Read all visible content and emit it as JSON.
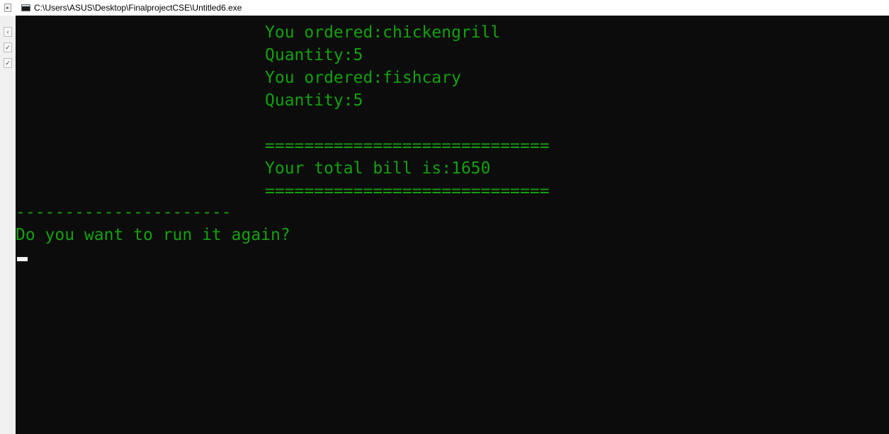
{
  "window": {
    "title": "C:\\Users\\ASUS\\Desktop\\FinalprojectCSE\\Untitled6.exe"
  },
  "console": {
    "text_color": "#13a10e",
    "background": "#0c0c0c",
    "lines": [
      "You ordered:chickengrill",
      "Quantity:5",
      "You ordered:fishcary",
      "Quantity:5",
      "=============================",
      "Your total bill is:1650",
      "=============================",
      "----------------------",
      "Do you want to run it again?"
    ]
  }
}
